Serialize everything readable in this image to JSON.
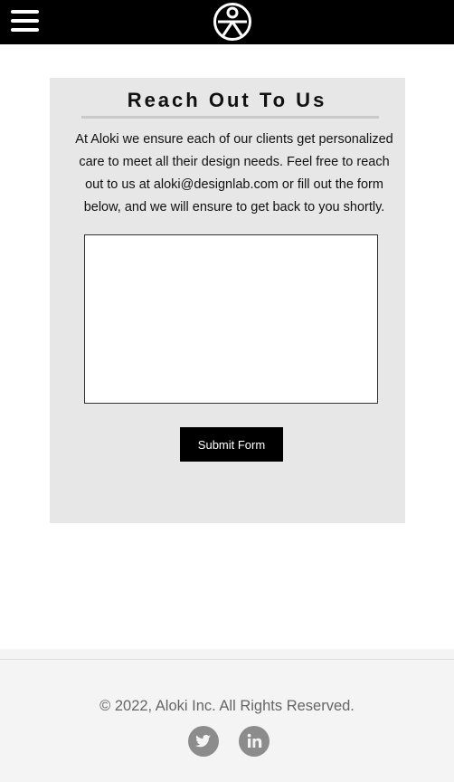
{
  "header": {
    "menu_icon": "hamburger-menu-icon",
    "logo_icon": "aloki-figure-logo"
  },
  "contact": {
    "title": "Reach Out To Us",
    "intro": "At Aloki we ensure each of our clients get personalized care to meet all their design needs. Feel free to reach out to us at aloki@designlab.com or fill out the form below, and we will ensure to get back to you shortly.",
    "message_value": "",
    "submit_label": "Submit Form"
  },
  "footer": {
    "copyright": "© 2022, Aloki Inc. All Rights Reserved.",
    "social": [
      {
        "icon": "twitter-icon"
      },
      {
        "icon": "linkedin-icon"
      }
    ]
  },
  "colors": {
    "header_bg": "#000000",
    "card_bg": "#e7e7e7",
    "button_bg": "#000000",
    "footer_bg": "#f4f4f4",
    "social_icon": "#8c8c8c"
  }
}
